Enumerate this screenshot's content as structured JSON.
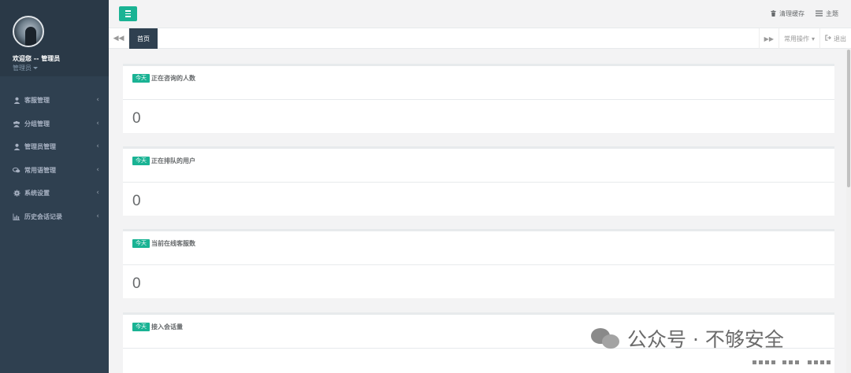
{
  "sidebar": {
    "welcome": "欢迎您 -- 管理员",
    "role": "管理员",
    "items": [
      {
        "label": "客服管理",
        "icon": "user-icon"
      },
      {
        "label": "分组管理",
        "icon": "users-icon"
      },
      {
        "label": "管理员管理",
        "icon": "user-icon"
      },
      {
        "label": "常用语管理",
        "icon": "comments-icon"
      },
      {
        "label": "系统设置",
        "icon": "gear-icon"
      },
      {
        "label": "历史会话记录",
        "icon": "bar-chart-icon"
      }
    ]
  },
  "topbar": {
    "clear_cache": "清理缓存",
    "theme": "主题"
  },
  "tabs": {
    "home": "首页",
    "common_ops": "常用操作",
    "logout": "退出"
  },
  "cards": [
    {
      "badge": "今天",
      "title": "正在咨询的人数",
      "value": "0"
    },
    {
      "badge": "今天",
      "title": "正在排队的用户",
      "value": "0"
    },
    {
      "badge": "今天",
      "title": "当前在线客服数",
      "value": "0"
    },
    {
      "badge": "今天",
      "title": "接入会话量",
      "value": ""
    }
  ],
  "watermark": "公众号 · 不够安全",
  "colors": {
    "accent": "#1ab394",
    "sidebar": "#2f4050"
  }
}
